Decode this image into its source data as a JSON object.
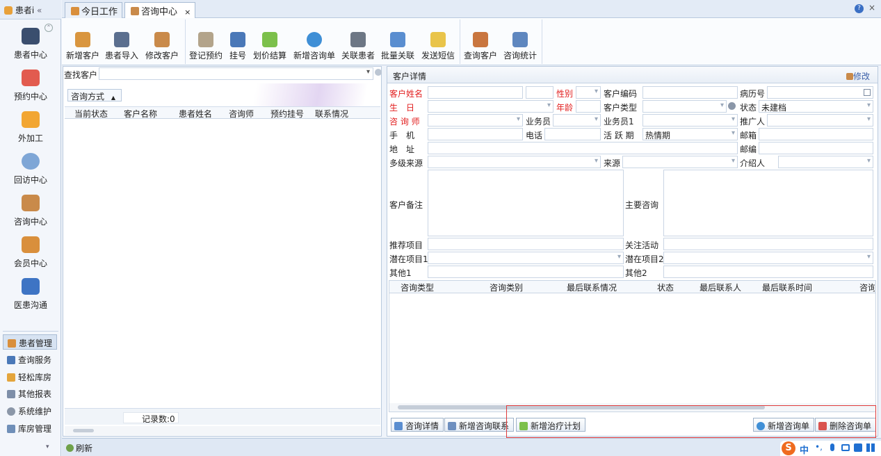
{
  "nav": {
    "title": "患者i",
    "collapse": "«",
    "items": [
      {
        "label": "患者中心",
        "icon": "binoculars-icon"
      },
      {
        "label": "预约中心",
        "icon": "calendar-icon"
      },
      {
        "label": "外加工",
        "icon": "cubes-icon"
      },
      {
        "label": "回访中心",
        "icon": "refresh-icon"
      },
      {
        "label": "咨询中心",
        "icon": "consult-user-icon"
      },
      {
        "label": "会员中心",
        "icon": "members-icon"
      },
      {
        "label": "医患沟通",
        "icon": "media-icon"
      }
    ],
    "sections": [
      "患者管理",
      "查询服务",
      "轻松库房",
      "其他报表",
      "系统维护",
      "库房管理"
    ]
  },
  "tabs": [
    {
      "label": "今日工作"
    },
    {
      "label": "咨询中心",
      "close": "×"
    }
  ],
  "window": {
    "help": "?",
    "close": "×"
  },
  "toolbar": [
    "新增客户",
    "患者导入",
    "修改客户",
    "登记预约",
    "挂号",
    "划价结算",
    "新增咨询单",
    "关联患者",
    "批量关联",
    "发送短信",
    "查询客户",
    "咨询统计"
  ],
  "left": {
    "search_label": "查找客户",
    "group_header": "咨询方式",
    "sort": "▲",
    "columns": [
      "当前状态",
      "客户名称",
      "患者姓名",
      "咨询师",
      "预约挂号",
      "联系情况"
    ],
    "record_label": "记录数:0"
  },
  "right": {
    "title": "客户详情",
    "edit": "修改",
    "labels": {
      "customer_name": "客户姓名",
      "gender": "性别",
      "customer_code": "客户编码",
      "record_no": "病历号",
      "birthday": "生　日",
      "age": "年龄",
      "customer_type": "客户类型",
      "status": "状态",
      "status_value": "未建档",
      "consultant": "咨 询 师",
      "salesman": "业务员",
      "salesman1": "业务员1",
      "promoter": "推广人",
      "mobile": "手　机",
      "phone": "电话",
      "active_period": "活 跃 期",
      "active_value": "热情期",
      "email": "邮箱",
      "address": "地　址",
      "postcode": "邮编",
      "multi_source": "多级来源",
      "source": "来源",
      "referrer": "介绍人",
      "remark": "客户备注",
      "main_consult": "主要咨询",
      "recommend": "推荐项目",
      "activity": "关注活动",
      "potential1": "潜在项目1",
      "potential2": "潜在项目2",
      "other1": "其他1",
      "other2": "其他2"
    },
    "grid_columns": [
      "咨询类型",
      "咨询类别",
      "最后联系情况",
      "状态",
      "最后联系人",
      "最后联系时间",
      "咨询"
    ],
    "buttons": [
      "咨询详情",
      "新增咨询联系",
      "新增治疗计划",
      "新增咨询单",
      "删除咨询单"
    ]
  },
  "status": {
    "refresh": "刷新"
  },
  "ime": {
    "s": "S",
    "zh": "中",
    "punct": "•,"
  }
}
